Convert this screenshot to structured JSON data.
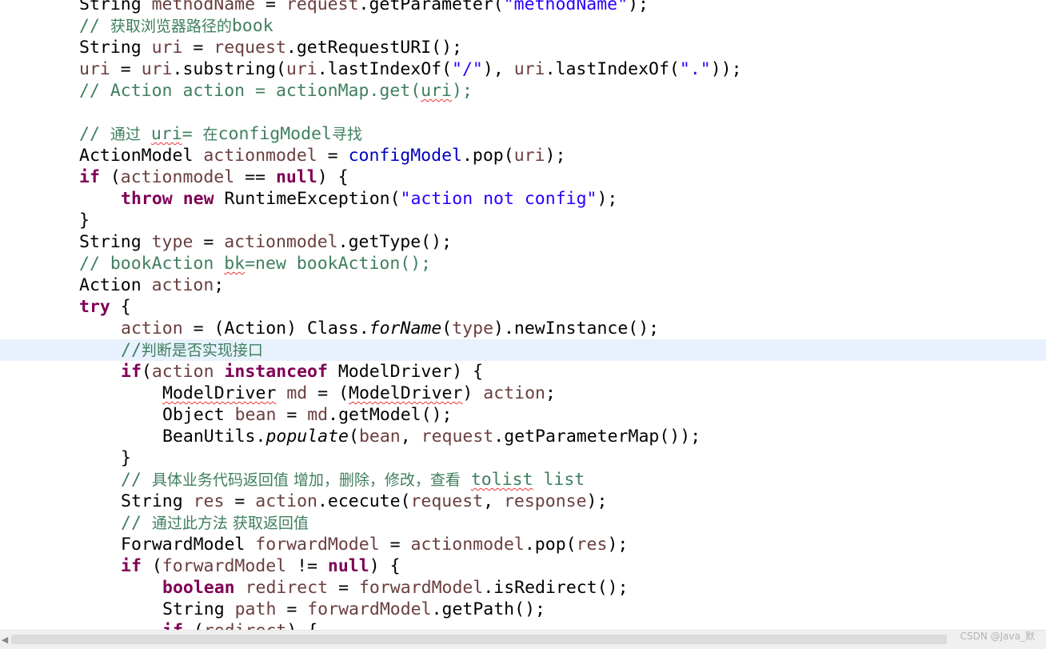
{
  "editor": {
    "language": "java",
    "current_line_index": 16,
    "colors": {
      "keyword": "#7f0055",
      "comment": "#3f7f5f",
      "string": "#2a00ff",
      "local_variable": "#6a3e3e",
      "field": "#0000c0",
      "current_line": "#e8f2fe",
      "squiggle": "#ee3333"
    },
    "lines": [
      {
        "indent": 1,
        "tokens": [
          [
            "String ",
            "pl"
          ],
          [
            "methodName",
            "var"
          ],
          [
            " = ",
            "pl"
          ],
          [
            "request",
            "var"
          ],
          [
            ".getParameter(",
            "pl"
          ],
          [
            "\"methodName\"",
            "str"
          ],
          [
            ");",
            "pl"
          ]
        ]
      },
      {
        "indent": 1,
        "tokens": [
          [
            "// ",
            "cm"
          ],
          [
            "获取浏览器路径的",
            "cm-cn"
          ],
          [
            "book",
            "cm"
          ]
        ]
      },
      {
        "indent": 1,
        "tokens": [
          [
            "String ",
            "pl"
          ],
          [
            "uri",
            "var"
          ],
          [
            " = ",
            "pl"
          ],
          [
            "request",
            "var"
          ],
          [
            ".getRequestURI();",
            "pl"
          ]
        ]
      },
      {
        "indent": 1,
        "tokens": [
          [
            "uri",
            "var"
          ],
          [
            " = ",
            "pl"
          ],
          [
            "uri",
            "var"
          ],
          [
            ".substring(",
            "pl"
          ],
          [
            "uri",
            "var"
          ],
          [
            ".lastIndexOf(",
            "pl"
          ],
          [
            "\"/\"",
            "str"
          ],
          [
            "), ",
            "pl"
          ],
          [
            "uri",
            "var"
          ],
          [
            ".lastIndexOf(",
            "pl"
          ],
          [
            "\".\"",
            "str"
          ],
          [
            "));",
            "pl"
          ]
        ]
      },
      {
        "indent": 1,
        "tokens": [
          [
            "// Action action = actionMap.get(",
            "cm"
          ],
          [
            "uri",
            "cm sq"
          ],
          [
            ");",
            "cm"
          ]
        ]
      },
      {
        "indent": 0,
        "tokens": []
      },
      {
        "indent": 1,
        "tokens": [
          [
            "// ",
            "cm"
          ],
          [
            "通过",
            "cm-cn"
          ],
          [
            " ",
            "cm"
          ],
          [
            "uri",
            "cm sq"
          ],
          [
            "= ",
            "cm"
          ],
          [
            "在",
            "cm-cn"
          ],
          [
            "configModel",
            "cm"
          ],
          [
            "寻找",
            "cm-cn"
          ]
        ]
      },
      {
        "indent": 1,
        "tokens": [
          [
            "ActionModel ",
            "pl"
          ],
          [
            "actionmodel",
            "var"
          ],
          [
            " = ",
            "pl"
          ],
          [
            "configModel",
            "fld"
          ],
          [
            ".pop(",
            "pl"
          ],
          [
            "uri",
            "var"
          ],
          [
            ");",
            "pl"
          ]
        ]
      },
      {
        "indent": 1,
        "tokens": [
          [
            "if",
            "kw"
          ],
          [
            " (",
            "pl"
          ],
          [
            "actionmodel",
            "var"
          ],
          [
            " == ",
            "pl"
          ],
          [
            "null",
            "kw"
          ],
          [
            ") {",
            "pl"
          ]
        ]
      },
      {
        "indent": 2,
        "tokens": [
          [
            "throw",
            "kw"
          ],
          [
            " ",
            "pl"
          ],
          [
            "new",
            "kw"
          ],
          [
            " RuntimeException(",
            "pl"
          ],
          [
            "\"action not config\"",
            "str"
          ],
          [
            ");",
            "pl"
          ]
        ]
      },
      {
        "indent": 1,
        "tokens": [
          [
            "}",
            "pl"
          ]
        ]
      },
      {
        "indent": 1,
        "tokens": [
          [
            "String ",
            "pl"
          ],
          [
            "type",
            "var"
          ],
          [
            " = ",
            "pl"
          ],
          [
            "actionmodel",
            "var"
          ],
          [
            ".getType();",
            "pl"
          ]
        ]
      },
      {
        "indent": 1,
        "tokens": [
          [
            "// bookAction ",
            "cm"
          ],
          [
            "bk",
            "cm sq"
          ],
          [
            "=new bookAction();",
            "cm"
          ]
        ]
      },
      {
        "indent": 1,
        "tokens": [
          [
            "Action ",
            "pl"
          ],
          [
            "action",
            "var"
          ],
          [
            ";",
            "pl"
          ]
        ]
      },
      {
        "indent": 1,
        "tokens": [
          [
            "try",
            "kw"
          ],
          [
            " {",
            "pl"
          ]
        ]
      },
      {
        "indent": 2,
        "tokens": [
          [
            "action",
            "var"
          ],
          [
            " = (Action) Class.",
            "pl"
          ],
          [
            "forName",
            "st"
          ],
          [
            "(",
            "pl"
          ],
          [
            "type",
            "var"
          ],
          [
            ").newInstance();",
            "pl"
          ]
        ]
      },
      {
        "indent": 2,
        "tokens": [
          [
            "//",
            "cm"
          ],
          [
            "判断是否实现接口",
            "cm-cn"
          ]
        ]
      },
      {
        "indent": 2,
        "tokens": [
          [
            "if",
            "kw"
          ],
          [
            "(",
            "pl"
          ],
          [
            "action",
            "var"
          ],
          [
            " ",
            "pl"
          ],
          [
            "instanceof",
            "kw"
          ],
          [
            " ModelDriver) {",
            "pl"
          ]
        ]
      },
      {
        "indent": 3,
        "tokens": [
          [
            "ModelDriver",
            "pl sq"
          ],
          [
            " ",
            "pl"
          ],
          [
            "md",
            "var"
          ],
          [
            " = (",
            "pl"
          ],
          [
            "ModelDriver",
            "pl sq"
          ],
          [
            ") ",
            "pl"
          ],
          [
            "action",
            "var"
          ],
          [
            ";",
            "pl"
          ]
        ]
      },
      {
        "indent": 3,
        "tokens": [
          [
            "Object ",
            "pl"
          ],
          [
            "bean",
            "var"
          ],
          [
            " = ",
            "pl"
          ],
          [
            "md",
            "var"
          ],
          [
            ".getModel();",
            "pl"
          ]
        ]
      },
      {
        "indent": 3,
        "tokens": [
          [
            "BeanUtils.",
            "pl"
          ],
          [
            "populate",
            "st"
          ],
          [
            "(",
            "pl"
          ],
          [
            "bean",
            "var"
          ],
          [
            ", ",
            "pl"
          ],
          [
            "request",
            "var"
          ],
          [
            ".getParameterMap());",
            "pl"
          ]
        ]
      },
      {
        "indent": 2,
        "tokens": [
          [
            "}",
            "pl"
          ]
        ]
      },
      {
        "indent": 2,
        "tokens": [
          [
            "// ",
            "cm"
          ],
          [
            "具体业务代码返回值 增加，删除，修改，查看",
            "cm-cn"
          ],
          [
            " ",
            "cm"
          ],
          [
            "tolist",
            "cm sq"
          ],
          [
            " ",
            "cm"
          ],
          [
            "list",
            "cm"
          ]
        ]
      },
      {
        "indent": 2,
        "tokens": [
          [
            "String ",
            "pl"
          ],
          [
            "res",
            "var"
          ],
          [
            " = ",
            "pl"
          ],
          [
            "action",
            "var"
          ],
          [
            ".ececute(",
            "pl"
          ],
          [
            "request",
            "var"
          ],
          [
            ", ",
            "pl"
          ],
          [
            "response",
            "var"
          ],
          [
            ");",
            "pl"
          ]
        ]
      },
      {
        "indent": 2,
        "tokens": [
          [
            "// ",
            "cm"
          ],
          [
            "通过此方法 获取返回值",
            "cm-cn"
          ]
        ]
      },
      {
        "indent": 2,
        "tokens": [
          [
            "ForwardModel ",
            "pl"
          ],
          [
            "forwardModel",
            "var"
          ],
          [
            " = ",
            "pl"
          ],
          [
            "actionmodel",
            "var"
          ],
          [
            ".pop(",
            "pl"
          ],
          [
            "res",
            "var"
          ],
          [
            ");",
            "pl"
          ]
        ]
      },
      {
        "indent": 2,
        "tokens": [
          [
            "if",
            "kw"
          ],
          [
            " (",
            "pl"
          ],
          [
            "forwardModel",
            "var"
          ],
          [
            " != ",
            "pl"
          ],
          [
            "null",
            "kw"
          ],
          [
            ") {",
            "pl"
          ]
        ]
      },
      {
        "indent": 3,
        "tokens": [
          [
            "boolean",
            "kw"
          ],
          [
            " ",
            "pl"
          ],
          [
            "redirect",
            "var"
          ],
          [
            " = ",
            "pl"
          ],
          [
            "forwardModel",
            "var"
          ],
          [
            ".isRedirect();",
            "pl"
          ]
        ]
      },
      {
        "indent": 3,
        "tokens": [
          [
            "String ",
            "pl"
          ],
          [
            "path",
            "var"
          ],
          [
            " = ",
            "pl"
          ],
          [
            "forwardModel",
            "var"
          ],
          [
            ".getPath();",
            "pl"
          ]
        ]
      },
      {
        "indent": 3,
        "tokens": [
          [
            "if",
            "kw"
          ],
          [
            " (",
            "pl"
          ],
          [
            "redirect",
            "var"
          ],
          [
            ") {",
            "pl"
          ]
        ]
      }
    ]
  },
  "scrollbar": {
    "left_arrow": "◀"
  },
  "watermark": {
    "text": "CSDN @Java_默"
  }
}
